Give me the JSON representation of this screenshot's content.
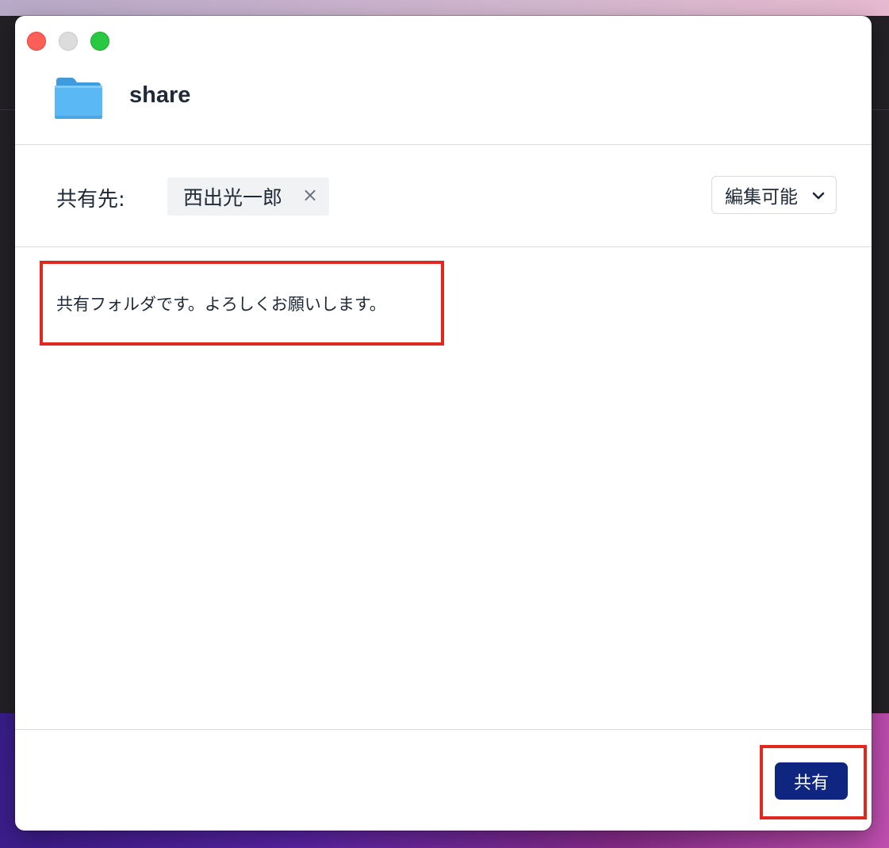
{
  "window": {
    "title": "share"
  },
  "share_to": {
    "label": "共有先:",
    "recipients": [
      {
        "name": "西出光一郎",
        "remove_symbol": "×"
      }
    ],
    "permission": {
      "selected": "編集可能"
    }
  },
  "message": {
    "text": "共有フォルダです。よろしくお願いします。"
  },
  "footer": {
    "share_button_label": "共有"
  },
  "colors": {
    "primary_button": "#0e2680",
    "highlight_border": "#e0281f",
    "folder_blue": "#5ab8f4"
  },
  "icons": {
    "folder": "folder-icon",
    "remove": "close-icon",
    "dropdown": "chevron-down-icon"
  }
}
